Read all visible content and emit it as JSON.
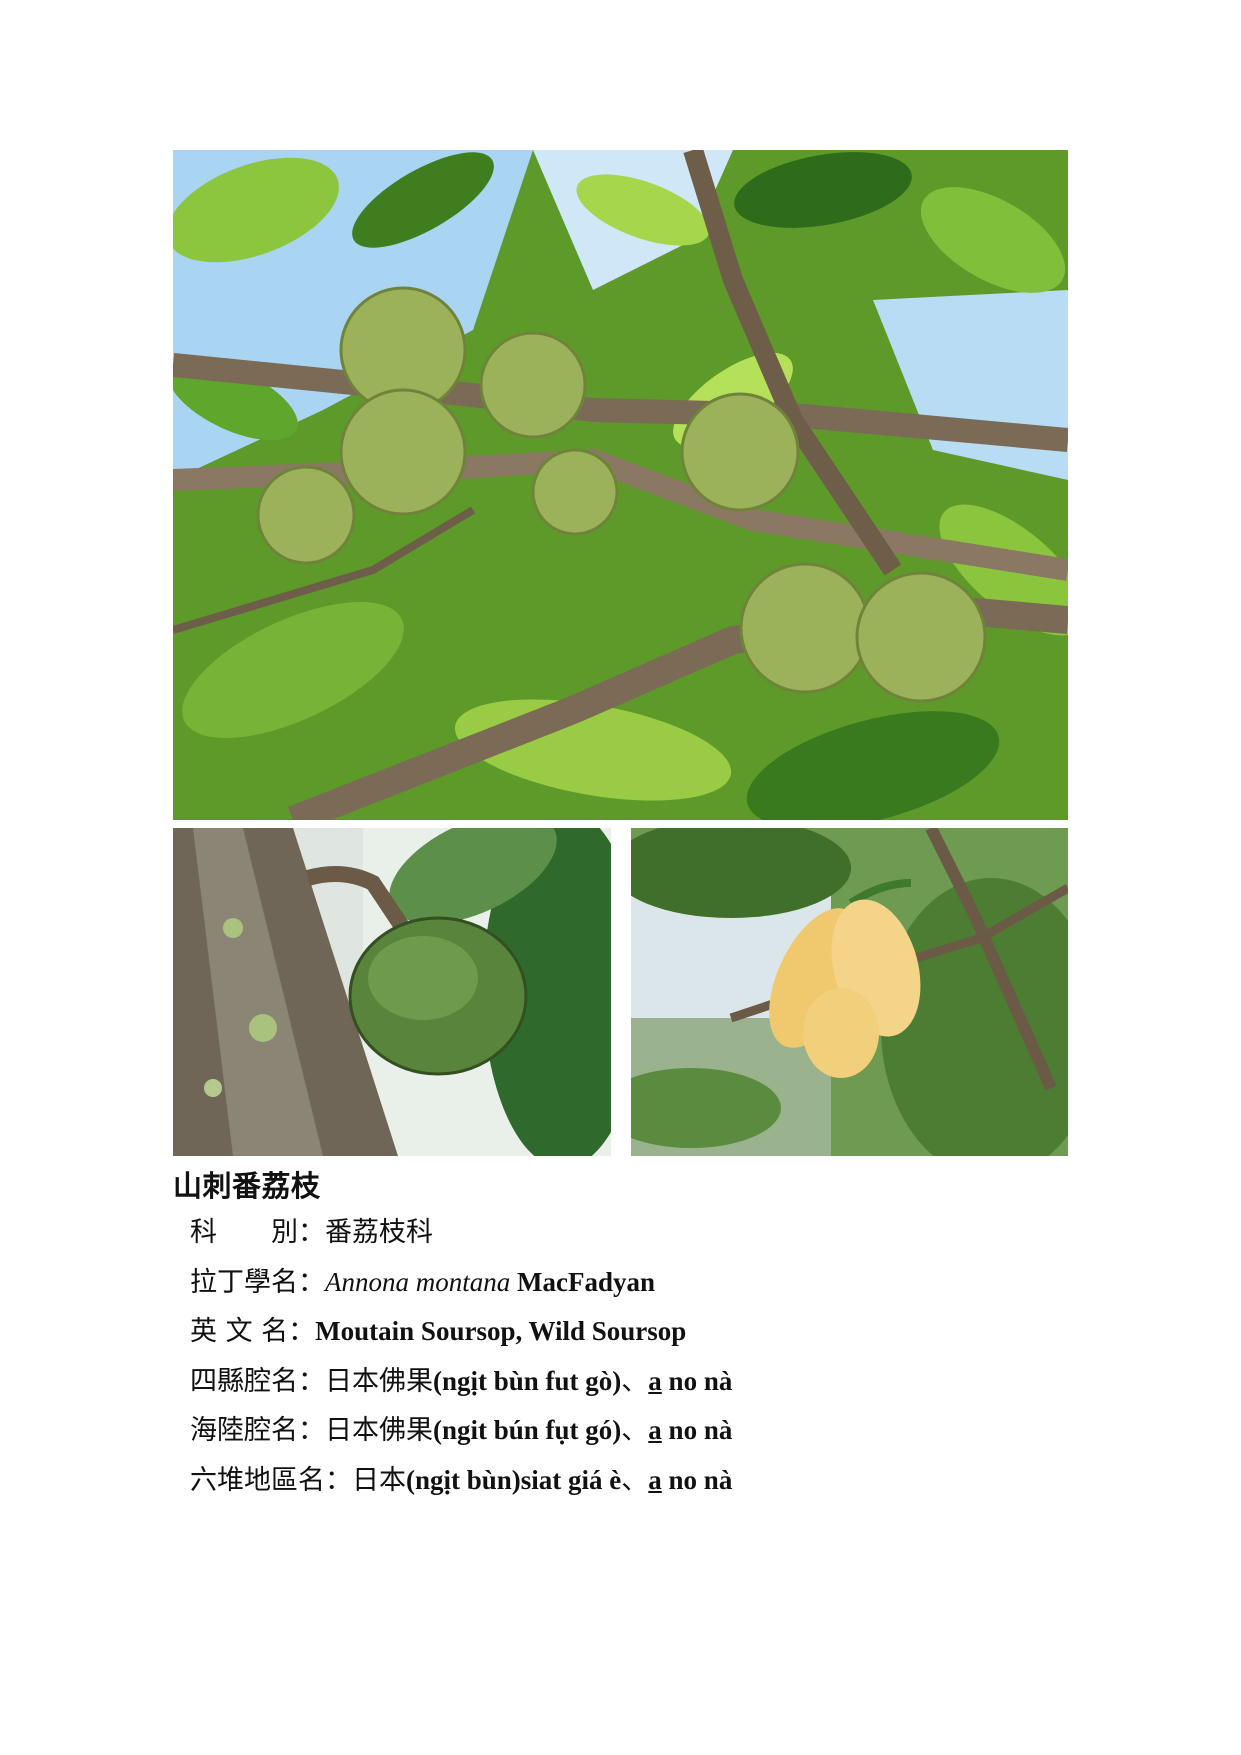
{
  "title": "山刺番荔枝",
  "rows": {
    "family": {
      "label": "科　　別",
      "sep": "：",
      "value": "番荔枝科"
    },
    "latin": {
      "label": "拉丁學名",
      "sep": "：",
      "genus_species": "Annona montana",
      "author": "MacFadyan"
    },
    "english": {
      "label": "英 文 名",
      "sep": "：",
      "value": "Moutain Soursop, Wild Soursop"
    },
    "sixian": {
      "label": "四縣腔名",
      "sep": "：",
      "cjk": "日本佛果",
      "roman": "(ngịt bùn fut gò)",
      "joiner": "、",
      "u": "a",
      "rest": " no nà"
    },
    "hailu": {
      "label": "海陸腔名",
      "sep": "：",
      "cjk": "日本佛果",
      "roman": "(ngit bún fụt gó)",
      "joiner": "、",
      "u": "a",
      "rest": " no nà"
    },
    "liudui": {
      "label": "六堆地區名",
      "sep": "：",
      "cjk": "日本",
      "roman": "(ngịt bùn)siat giá è",
      "joiner": "、",
      "u": "a",
      "rest": " no nà"
    }
  },
  "colors": {
    "leaf_dark": "#2f6b1a",
    "leaf_light": "#9fd14a",
    "sky": "#a9d4f2",
    "fruit": "#8aa24a",
    "bark": "#7b6a55",
    "flower": "#f2cf7a"
  },
  "images": [
    "soursop-tree-photo",
    "soursop-fruit-photo",
    "soursop-flower-photo"
  ]
}
